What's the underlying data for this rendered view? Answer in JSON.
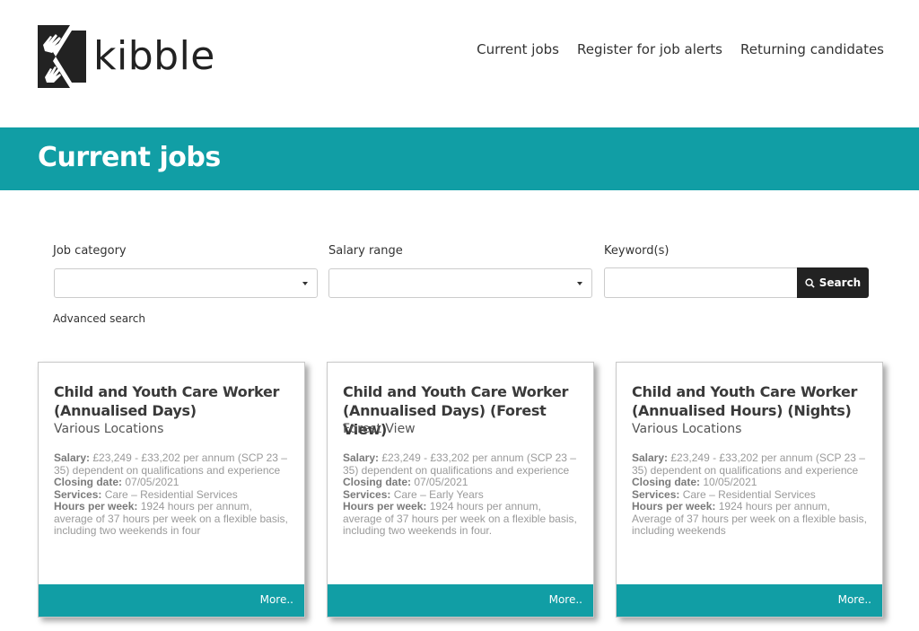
{
  "brand": {
    "name": "kibble",
    "logo_icon": "kibble-k-hands-icon",
    "accent_color": "#119ea5"
  },
  "nav": {
    "items": [
      "Current jobs",
      "Register for job alerts",
      "Returning candidates"
    ]
  },
  "banner": {
    "title": "Current jobs"
  },
  "search": {
    "category_label": "Job category",
    "category_value": "",
    "salary_label": "Salary range",
    "salary_value": "",
    "keyword_label": "Keyword(s)",
    "keyword_value": "",
    "button_label": "Search",
    "button_icon": "search-icon",
    "advanced_link": "Advanced search"
  },
  "jobs": [
    {
      "title": "Child and Youth Care Worker (Annualised Days)",
      "location": "Various Locations",
      "salary_label": "Salary:",
      "salary": "£23,249 - £33,202 per annum (SCP 23 – 35) dependent on qualifications and experience",
      "closing_label": "Closing date:",
      "closing": "07/05/2021",
      "services_label": "Services:",
      "services": "Care – Residential Services",
      "hours_label": "Hours per week:",
      "hours": "1924 hours per annum, average of 37 hours per week on a flexible basis, including two weekends in four",
      "more": "More.."
    },
    {
      "title": "Child and Youth Care Worker (Annualised Days) (Forest View)",
      "location": "Forest View",
      "salary_label": "Salary:",
      "salary": "£23,249 - £33,202 per annum (SCP 23 – 35) dependent on qualifications and experience",
      "closing_label": "Closing date:",
      "closing": "07/05/2021",
      "services_label": "Services:",
      "services": "Care – Early Years",
      "hours_label": "Hours per week:",
      "hours": "1924 hours per annum, average of 37 hours per week on a flexible basis, including two weekends in four.",
      "more": "More.."
    },
    {
      "title": "Child and Youth Care Worker (Annualised Hours) (Nights)",
      "location": "Various Locations",
      "salary_label": "Salary:",
      "salary": "£23,249 - £33,202 per annum (SCP 23 – 35) dependent on qualifications and experience",
      "closing_label": "Closing date:",
      "closing": "10/05/2021",
      "services_label": "Services:",
      "services": "Care – Residential Services",
      "hours_label": "Hours per week:",
      "hours": "1924 hours per annum, Average of 37 hours per week on a flexible basis, including weekends",
      "more": "More.."
    }
  ]
}
